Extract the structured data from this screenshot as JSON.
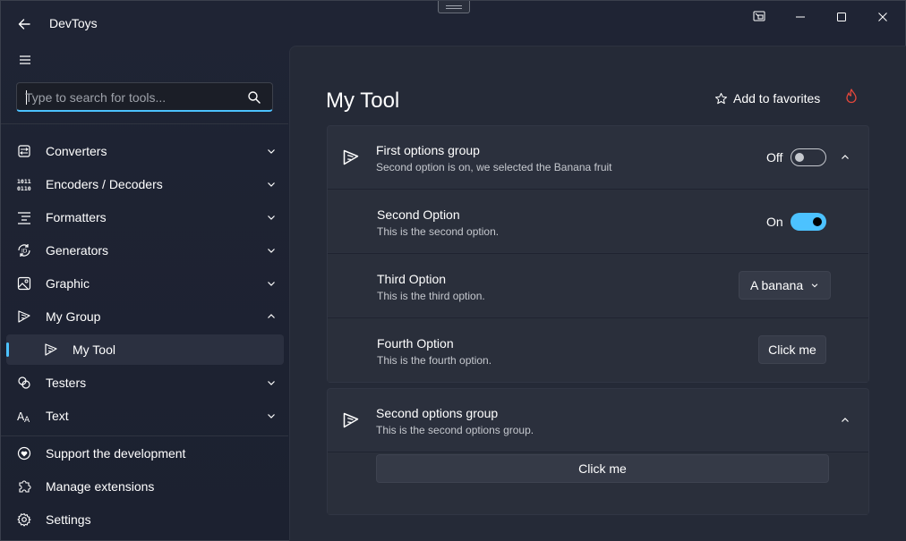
{
  "app": {
    "title": "DevToys"
  },
  "colors": {
    "accent": "#4cc2ff",
    "flame": "#e5473b"
  },
  "search": {
    "placeholder": "Type to search for tools..."
  },
  "sidebar": {
    "items": [
      {
        "label": "Converters",
        "icon": "converters-icon",
        "chevron": "down"
      },
      {
        "label": "Encoders / Decoders",
        "icon": "binary-icon",
        "chevron": "down"
      },
      {
        "label": "Formatters",
        "icon": "formatter-icon",
        "chevron": "down"
      },
      {
        "label": "Generators",
        "icon": "generator-icon",
        "chevron": "down"
      },
      {
        "label": "Graphic",
        "icon": "image-icon",
        "chevron": "down"
      },
      {
        "label": "My Group",
        "icon": "pencil-icon",
        "chevron": "up"
      },
      {
        "label": "My Tool",
        "icon": "pencil-icon",
        "selected": true
      },
      {
        "label": "Testers",
        "icon": "testers-icon",
        "chevron": "down"
      },
      {
        "label": "Text",
        "icon": "text-icon",
        "chevron": "down"
      }
    ],
    "footer": [
      {
        "label": "Support the development",
        "icon": "heart-icon"
      },
      {
        "label": "Manage extensions",
        "icon": "puzzle-icon"
      },
      {
        "label": "Settings",
        "icon": "gear-icon"
      }
    ]
  },
  "main": {
    "title": "My Tool",
    "favorites_label": "Add to favorites",
    "group1": {
      "title": "First options group",
      "desc": "Second option is on, we selected the Banana fruit",
      "toggle_label": "Off",
      "toggle_on": false
    },
    "second_option": {
      "title": "Second Option",
      "desc": "This is the second option.",
      "toggle_label": "On",
      "toggle_on": true
    },
    "third_option": {
      "title": "Third Option",
      "desc": "This is the third option.",
      "selected": "A banana"
    },
    "fourth_option": {
      "title": "Fourth Option",
      "desc": "This is the fourth option.",
      "button_label": "Click me"
    },
    "group2": {
      "title": "Second options group",
      "desc": "This is the second options group.",
      "button_label": "Click me"
    }
  }
}
